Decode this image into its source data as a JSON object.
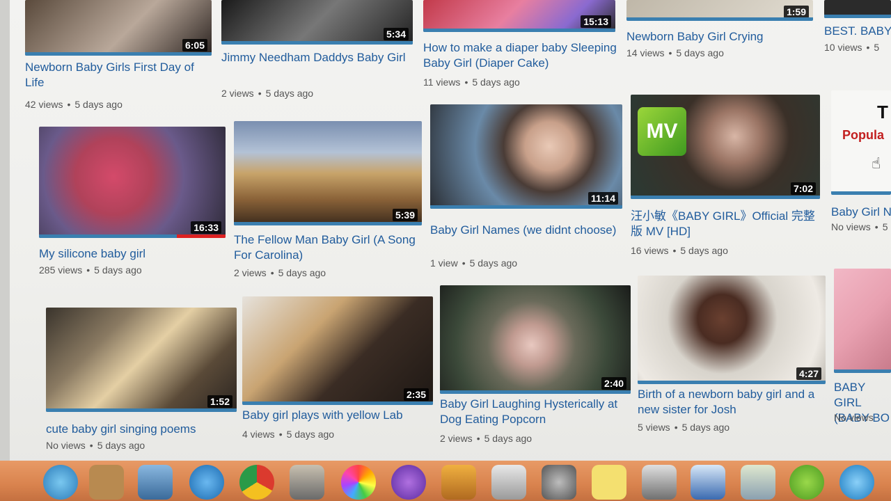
{
  "videos": [
    {
      "title": "Newborn Baby Girls First Day of Life",
      "views": "42 views",
      "age": "5 days ago",
      "duration": "6:05"
    },
    {
      "title": "Jimmy Needham Daddys Baby Girl",
      "views": "2 views",
      "age": "5 days ago",
      "duration": "5:34"
    },
    {
      "title": "How to make a diaper baby Sleeping Baby Girl (Diaper Cake)",
      "views": "11 views",
      "age": "5 days ago",
      "duration": "15:13"
    },
    {
      "title": "Newborn Baby Girl Crying",
      "views": "14 views",
      "age": "5 days ago",
      "duration": "1:59"
    },
    {
      "title": "BEST. BABY",
      "views": "10 views",
      "age": "5",
      "duration": ""
    },
    {
      "title": "My silicone baby girl",
      "views": "285 views",
      "age": "5 days ago",
      "duration": "16:33"
    },
    {
      "title": "The Fellow Man Baby Girl (A Song For Carolina)",
      "views": "2 views",
      "age": "5 days ago",
      "duration": "5:39"
    },
    {
      "title": "Baby Girl Names (we didnt choose)",
      "views": "1 view",
      "age": "5 days ago",
      "duration": "11:14"
    },
    {
      "title": "汪小敏《BABY GIRL》Official 完整版 MV [HD]",
      "views": "16 views",
      "age": "5 days ago",
      "duration": "7:02",
      "badge": "MV"
    },
    {
      "title": "Baby Girl N",
      "views": "No views",
      "age": "5",
      "duration": "",
      "thumb_text_1": "T",
      "thumb_text_2": "Popula"
    },
    {
      "title": "cute baby girl singing poems",
      "views": "No views",
      "age": "5 days ago",
      "duration": "1:52"
    },
    {
      "title": "Baby girl plays with yellow Lab",
      "views": "4 views",
      "age": "5 days ago",
      "duration": "2:35"
    },
    {
      "title": "Baby Girl Laughing Hysterically at Dog Eating Popcorn",
      "views": "2 views",
      "age": "5 days ago",
      "duration": "2:40"
    },
    {
      "title": "Birth of a newborn baby girl and a new sister for Josh",
      "views": "5 views",
      "age": "5 days ago",
      "duration": "4:27"
    },
    {
      "title": "BABY GIRL (BABY BO",
      "views": "No views",
      "age": "",
      "duration": ""
    }
  ],
  "dock_icons": [
    "safari-icon",
    "chrome-icon",
    "preview-icon",
    "photos-icon",
    "imovie-icon",
    "keynote-icon",
    "numbers-icon",
    "system-preferences-icon",
    "stickies-icon",
    "printer-icon",
    "hp-icon",
    "utility-icon",
    "android-icon",
    "quicktime-icon"
  ],
  "colors": {
    "title": "#215c9c",
    "meta": "#555555",
    "watched_bar": "#3a7fb0",
    "progress": "#dd2222",
    "dock": "#d9834e"
  }
}
